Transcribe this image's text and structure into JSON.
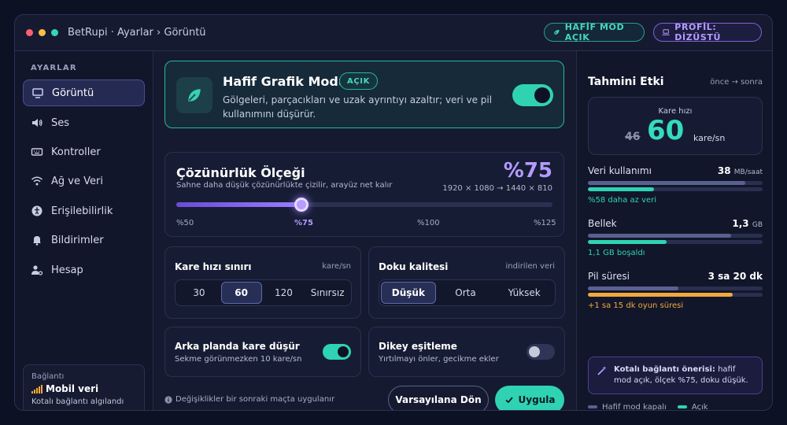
{
  "window": {
    "breadcrumb": "BetRupi · Ayarlar › Görüntü",
    "lite_badge": "HAFİF MOD AÇIK",
    "profile_badge": "PROFİL: DİZÜSTÜ"
  },
  "sidebar": {
    "heading": "AYARLAR",
    "items": [
      {
        "label": "Görüntü",
        "icon": "monitor-icon"
      },
      {
        "label": "Ses",
        "icon": "speaker-icon"
      },
      {
        "label": "Kontroller",
        "icon": "keyboard-icon"
      },
      {
        "label": "Ağ ve Veri",
        "icon": "wifi-icon"
      },
      {
        "label": "Erişilebilirlik",
        "icon": "accessibility-icon"
      },
      {
        "label": "Bildirimler",
        "icon": "bell-icon"
      },
      {
        "label": "Hesap",
        "icon": "user-gear-icon"
      }
    ],
    "connection": {
      "label": "Bağlantı",
      "value": "Mobil veri",
      "sub": "Kotalı bağlantı algılandı"
    }
  },
  "lite_mode": {
    "title": "Hafif Grafik Modu",
    "badge": "AÇIK",
    "description": "Gölgeleri, parçacıkları ve uzak ayrıntıyı azaltır; veri ve pil kullanımını düşürür.",
    "enabled": true
  },
  "scale": {
    "title": "Çözünürlük Ölçeği",
    "subtitle": "Sahne daha düşük çözünürlükte çizilir, arayüz net kalır",
    "value": "%75",
    "resolution": "1920 × 1080 → 1440 × 810",
    "level": 0.3333,
    "ticks": [
      "%50",
      "%75",
      "%100",
      "%125"
    ]
  },
  "fps_limit": {
    "title": "Kare hızı sınırı",
    "unit": "kare/sn",
    "options": [
      "30",
      "60",
      "120",
      "Sınırsız"
    ],
    "selected": "60"
  },
  "texture": {
    "title": "Doku kalitesi",
    "note": "indirilen veri",
    "options": [
      "Düşük",
      "Orta",
      "Yüksek"
    ],
    "selected": "Düşük"
  },
  "background_fps": {
    "title": "Arka planda kare düşür",
    "description": "Sekme görünmezken 10 kare/sn",
    "enabled": true
  },
  "vsync": {
    "title": "Dikey eşitleme",
    "description": "Yırtılmayı önler, gecikme ekler",
    "enabled": false
  },
  "footer": {
    "note": "Değişiklikler bir sonraki maçta uygulanır",
    "reset_label": "Varsayılana Dön",
    "apply_label": "Uygula"
  },
  "impact": {
    "title": "Tahmini Etki",
    "subtitle": "önce → sonra",
    "fps": {
      "label": "Kare hızı",
      "before": "46",
      "after": "60",
      "unit": "kare/sn"
    },
    "metrics": [
      {
        "label": "Veri kullanımı",
        "value": "38",
        "unit": "MB/saat",
        "note": "%58 daha az veri",
        "before": 0.9,
        "after": 0.38,
        "color": "#2fd3b4"
      },
      {
        "label": "Bellek",
        "value": "1,3",
        "unit": "GB",
        "note": "1,1 GB boşaldı",
        "before": 0.82,
        "after": 0.45,
        "color": "#2fd3b4"
      },
      {
        "label": "Pil süresi",
        "value": "3 sa 20 dk",
        "unit": "",
        "note": "+1 sa 15 dk oyun süresi",
        "before": 0.52,
        "after": 0.83,
        "color": "#f2a93b"
      }
    ],
    "tip_title": "Kotalı bağlantı önerisi:",
    "tip_text": "hafif mod açık, ölçek %75, doku düşük.",
    "legend": {
      "off": "Hafif mod kapalı",
      "on": "Açık"
    }
  },
  "colors": {
    "accent": "#2fd3b4",
    "purple": "#9a7dff",
    "warning": "#f2a93b"
  }
}
